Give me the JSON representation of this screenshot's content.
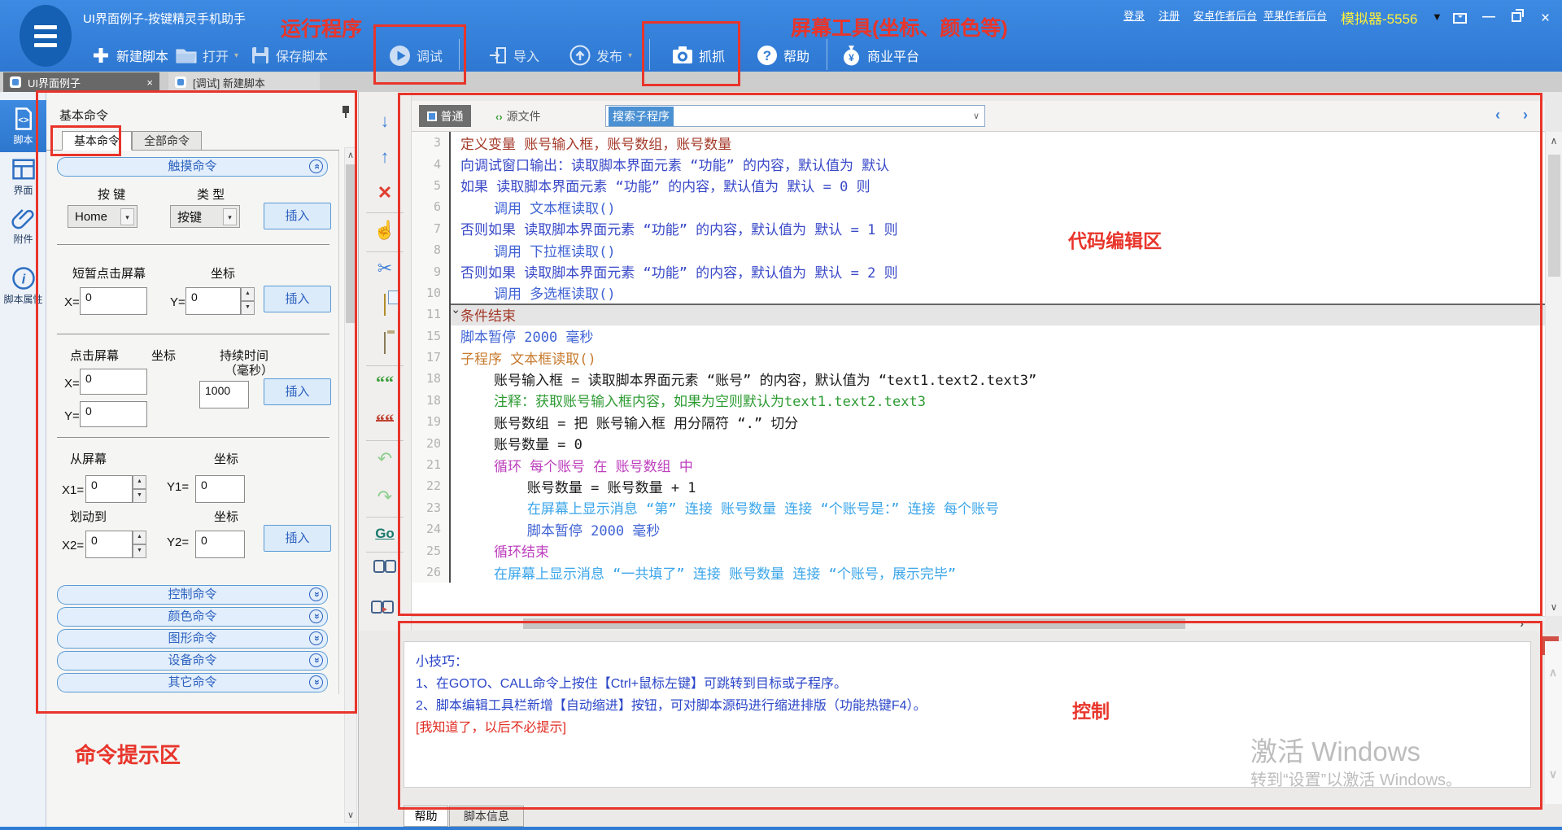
{
  "window": {
    "title": "UI界面例子-按键精灵手机助手",
    "links": [
      "登录",
      "注册",
      "安卓作者后台",
      "苹果作者后台"
    ],
    "emulator": "模拟器-5556"
  },
  "toolbar": {
    "new": "新建脚本",
    "open": "打开",
    "save": "保存脚本",
    "debug": "调试",
    "import": "导入",
    "publish": "发布",
    "grab": "抓抓",
    "help": "帮助",
    "biz": "商业平台"
  },
  "doc_tabs": {
    "tab1": "UI界面例子",
    "tab2": "[调试] 新建脚本"
  },
  "sidebar": {
    "script": "脚本",
    "ui": "界面",
    "attach": "附件",
    "props": "脚本属性"
  },
  "panel": {
    "title": "基本命令",
    "tab_basic": "基本命令",
    "tab_all": "全部命令",
    "touch": {
      "title": "触摸命令",
      "key_label": "按 键",
      "type_label": "类 型",
      "key_value": "Home",
      "type_value": "按键",
      "insert": "插入",
      "tap_label": "短暂点击屏幕",
      "coord_label": "坐标",
      "x_label": "X=",
      "y_label": "Y=",
      "x_value": "0",
      "y_value": "0",
      "press_label": "点击屏幕",
      "duration_label": "持续时间",
      "duration_label2": "（毫秒）",
      "duration_value": "1000",
      "swipe_from": "从屏幕",
      "swipe_to": "划动到",
      "x1_label": "X1=",
      "y1_label": "Y1=",
      "x2_label": "X2=",
      "y2_label": "Y2=",
      "x1": "0",
      "y1": "0",
      "x2": "0",
      "y2": "0"
    },
    "sections": [
      "控制命令",
      "颜色命令",
      "图形命令",
      "设备命令",
      "其它命令"
    ]
  },
  "editor": {
    "mode_normal": "普通",
    "mode_source": "源文件",
    "search": "搜索子程序",
    "lines": [
      {
        "num": "3",
        "text": "定义变量 账号输入框，账号数组，账号数量",
        "cls": "c-red"
      },
      {
        "num": "4",
        "text": "向调试窗口输出：读取脚本界面元素 “功能” 的内容，默认值为 默认",
        "cls": "c-blue"
      },
      {
        "num": "5",
        "text": "如果 读取脚本界面元素 “功能” 的内容，默认值为 默认 = 0 则",
        "cls": "c-blue"
      },
      {
        "num": "6",
        "text": "    调用 文本框读取()",
        "cls": "c-blue2"
      },
      {
        "num": "7",
        "text": "否则如果 读取脚本界面元素 “功能” 的内容，默认值为 默认 = 1 则",
        "cls": "c-blue"
      },
      {
        "num": "8",
        "text": "    调用 下拉框读取()",
        "cls": "c-blue2"
      },
      {
        "num": "9",
        "text": "否则如果 读取脚本界面元素 “功能” 的内容，默认值为 默认 = 2 则",
        "cls": "c-blue"
      },
      {
        "num": "10",
        "text": "    调用 多选框读取()",
        "cls": "c-blue2"
      },
      {
        "num": "11",
        "text": "条件结束",
        "cls": "c-red",
        "row": "hl"
      },
      {
        "num": "15",
        "text": "脚本暂停 2000 毫秒",
        "cls": "c-blue2"
      },
      {
        "num": "17",
        "text": "子程序 文本框读取()",
        "cls": "c-orange"
      },
      {
        "num": "18",
        "text": "    账号输入框 = 读取脚本界面元素 “账号” 的内容，默认值为 “text1.text2.text3”",
        "cls": "c-black"
      },
      {
        "num": "18",
        "text": "    注释：获取账号输入框内容，如果为空则默认为text1.text2.text3",
        "cls": "c-green"
      },
      {
        "num": "19",
        "text": "    账号数组 = 把 账号输入框 用分隔符 “.” 切分",
        "cls": "c-black"
      },
      {
        "num": "20",
        "text": "    账号数量 = 0",
        "cls": "c-black"
      },
      {
        "num": "21",
        "text": "    循环 每个账号 在 账号数组 中",
        "cls": "c-magenta"
      },
      {
        "num": "22",
        "text": "        账号数量 = 账号数量 + 1",
        "cls": "c-black"
      },
      {
        "num": "23",
        "text": "        在屏幕上显示消息 “第” 连接 账号数量 连接 “个账号是：” 连接 每个账号",
        "cls": "c-lblue"
      },
      {
        "num": "24",
        "text": "        脚本暂停 2000 毫秒",
        "cls": "c-blue2"
      },
      {
        "num": "25",
        "text": "    循环结束",
        "cls": "c-magenta"
      },
      {
        "num": "26",
        "text": "    在屏幕上显示消息 “一共填了” 连接 账号数量 连接 “个账号，展示完毕”",
        "cls": "c-lblue"
      }
    ]
  },
  "bottom": {
    "tips": [
      "小技巧：",
      "1、在GOTO、CALL命令上按住【Ctrl+鼠标左键】可跳转到目标或子程序。",
      "2、脚本编辑工具栏新增【自动缩进】按钮，可对脚本源码进行缩进排版（功能热键F4）。"
    ],
    "dismiss": "[我知道了，以后不必提示]",
    "close": "x",
    "tab_help": "帮助",
    "tab_info": "脚本信息",
    "watermark1": "激活 Windows",
    "watermark2": "转到“设置”以激活 Windows。"
  },
  "annotations": {
    "run": "运行程序",
    "screen": "屏幕工具(坐标、颜色等)",
    "editor": "代码编辑区",
    "control": "控制",
    "hint": "命令提示区"
  },
  "colors": {
    "accent_blue": "#2f7cd4",
    "annotation_red": "#e8352b",
    "emulator_yellow": "#ffef3a"
  }
}
